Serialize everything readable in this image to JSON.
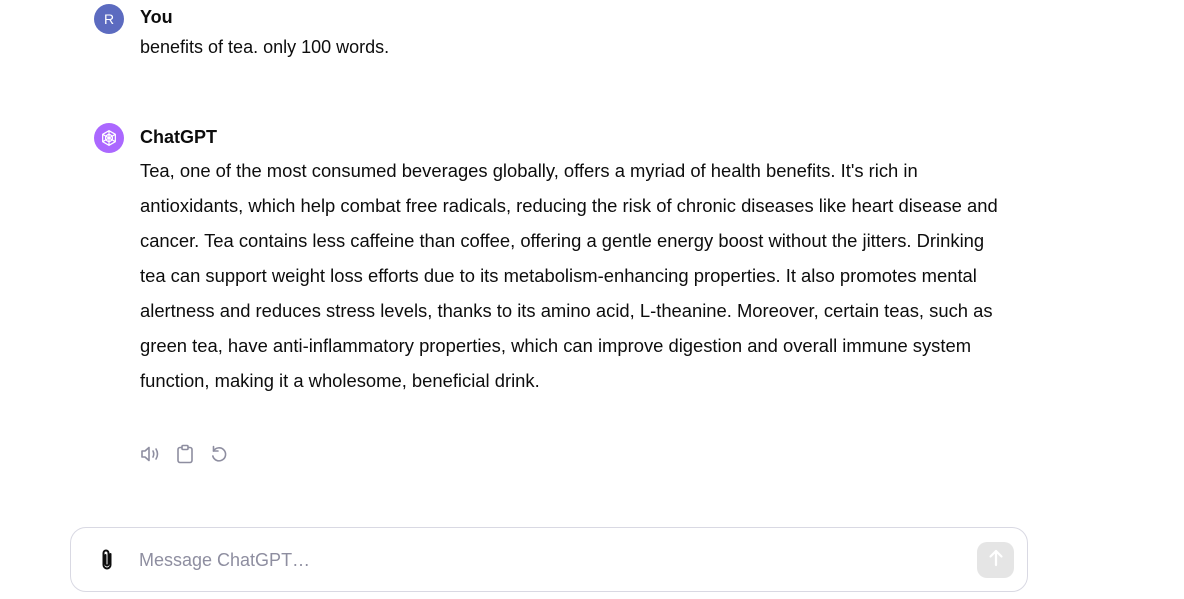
{
  "conversation": {
    "user": {
      "avatar_initial": "R",
      "author": "You",
      "message": "benefits of tea. only 100 words."
    },
    "assistant": {
      "author": "ChatGPT",
      "avatar_icon": "openai-logo-icon",
      "message": "Tea, one of the most consumed beverages globally, offers a myriad of health benefits. It's rich in antioxidants, which help combat free radicals, reducing the risk of chronic diseases like heart disease and cancer. Tea contains less caffeine than coffee, offering a gentle energy boost without the jitters. Drinking tea can support weight loss efforts due to its metabolism-enhancing properties. It also promotes mental alertness and reduces stress levels, thanks to its amino acid, L-theanine. Moreover, certain teas, such as green tea, have anti-inflammatory properties, which can improve digestion and overall immune system function, making it a wholesome, beneficial drink.",
      "actions": [
        "read-aloud-icon",
        "copy-icon",
        "regenerate-icon"
      ]
    }
  },
  "composer": {
    "placeholder": "Message ChatGPT…",
    "value": "",
    "attach_icon": "paperclip-icon",
    "send_icon": "arrow-up-icon"
  },
  "colors": {
    "user_avatar": "#5c6bc0",
    "assistant_avatar": "#ab68ff",
    "send_button_disabled": "#e5e5e5",
    "border": "#d9d9e3"
  }
}
